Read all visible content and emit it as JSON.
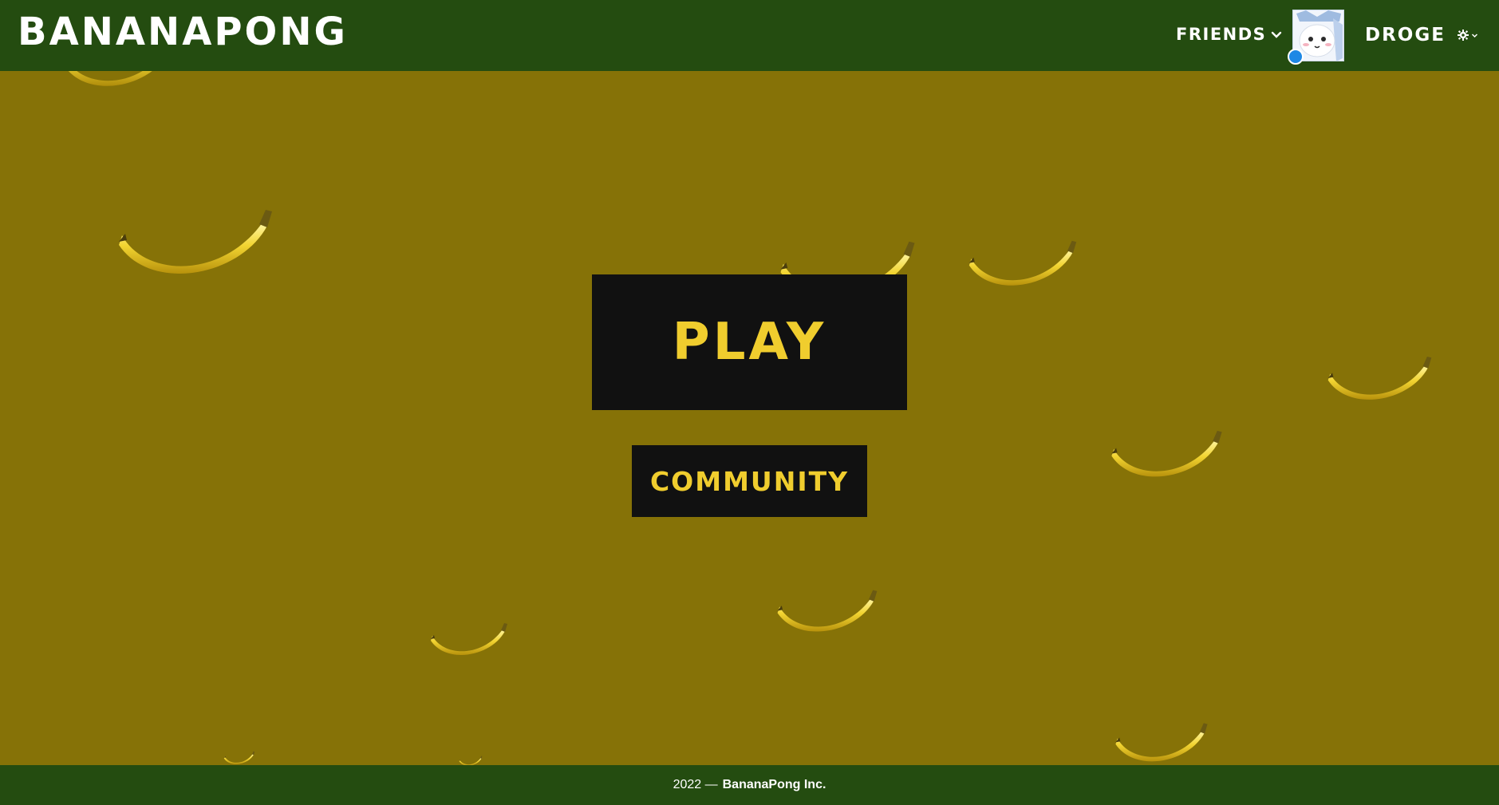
{
  "header": {
    "logo": "BANANAPONG",
    "friends_label": "FRIENDS",
    "username": "DROGE"
  },
  "main": {
    "play_label": "PLAY",
    "community_label": "COMMUNITY"
  },
  "footer": {
    "year_text": "2022 —",
    "company": "BananaPong Inc."
  },
  "icons": {
    "friends_dropdown": "chevron-down-icon",
    "settings": "gear-icon",
    "settings_dropdown": "chevron-down-icon",
    "decor": "banana-icon"
  },
  "colors": {
    "header_bg": "#244c10",
    "page_bg": "#867207",
    "button_bg": "#111111",
    "button_text": "#f0cd2e",
    "status_dot": "#1e88e5"
  }
}
